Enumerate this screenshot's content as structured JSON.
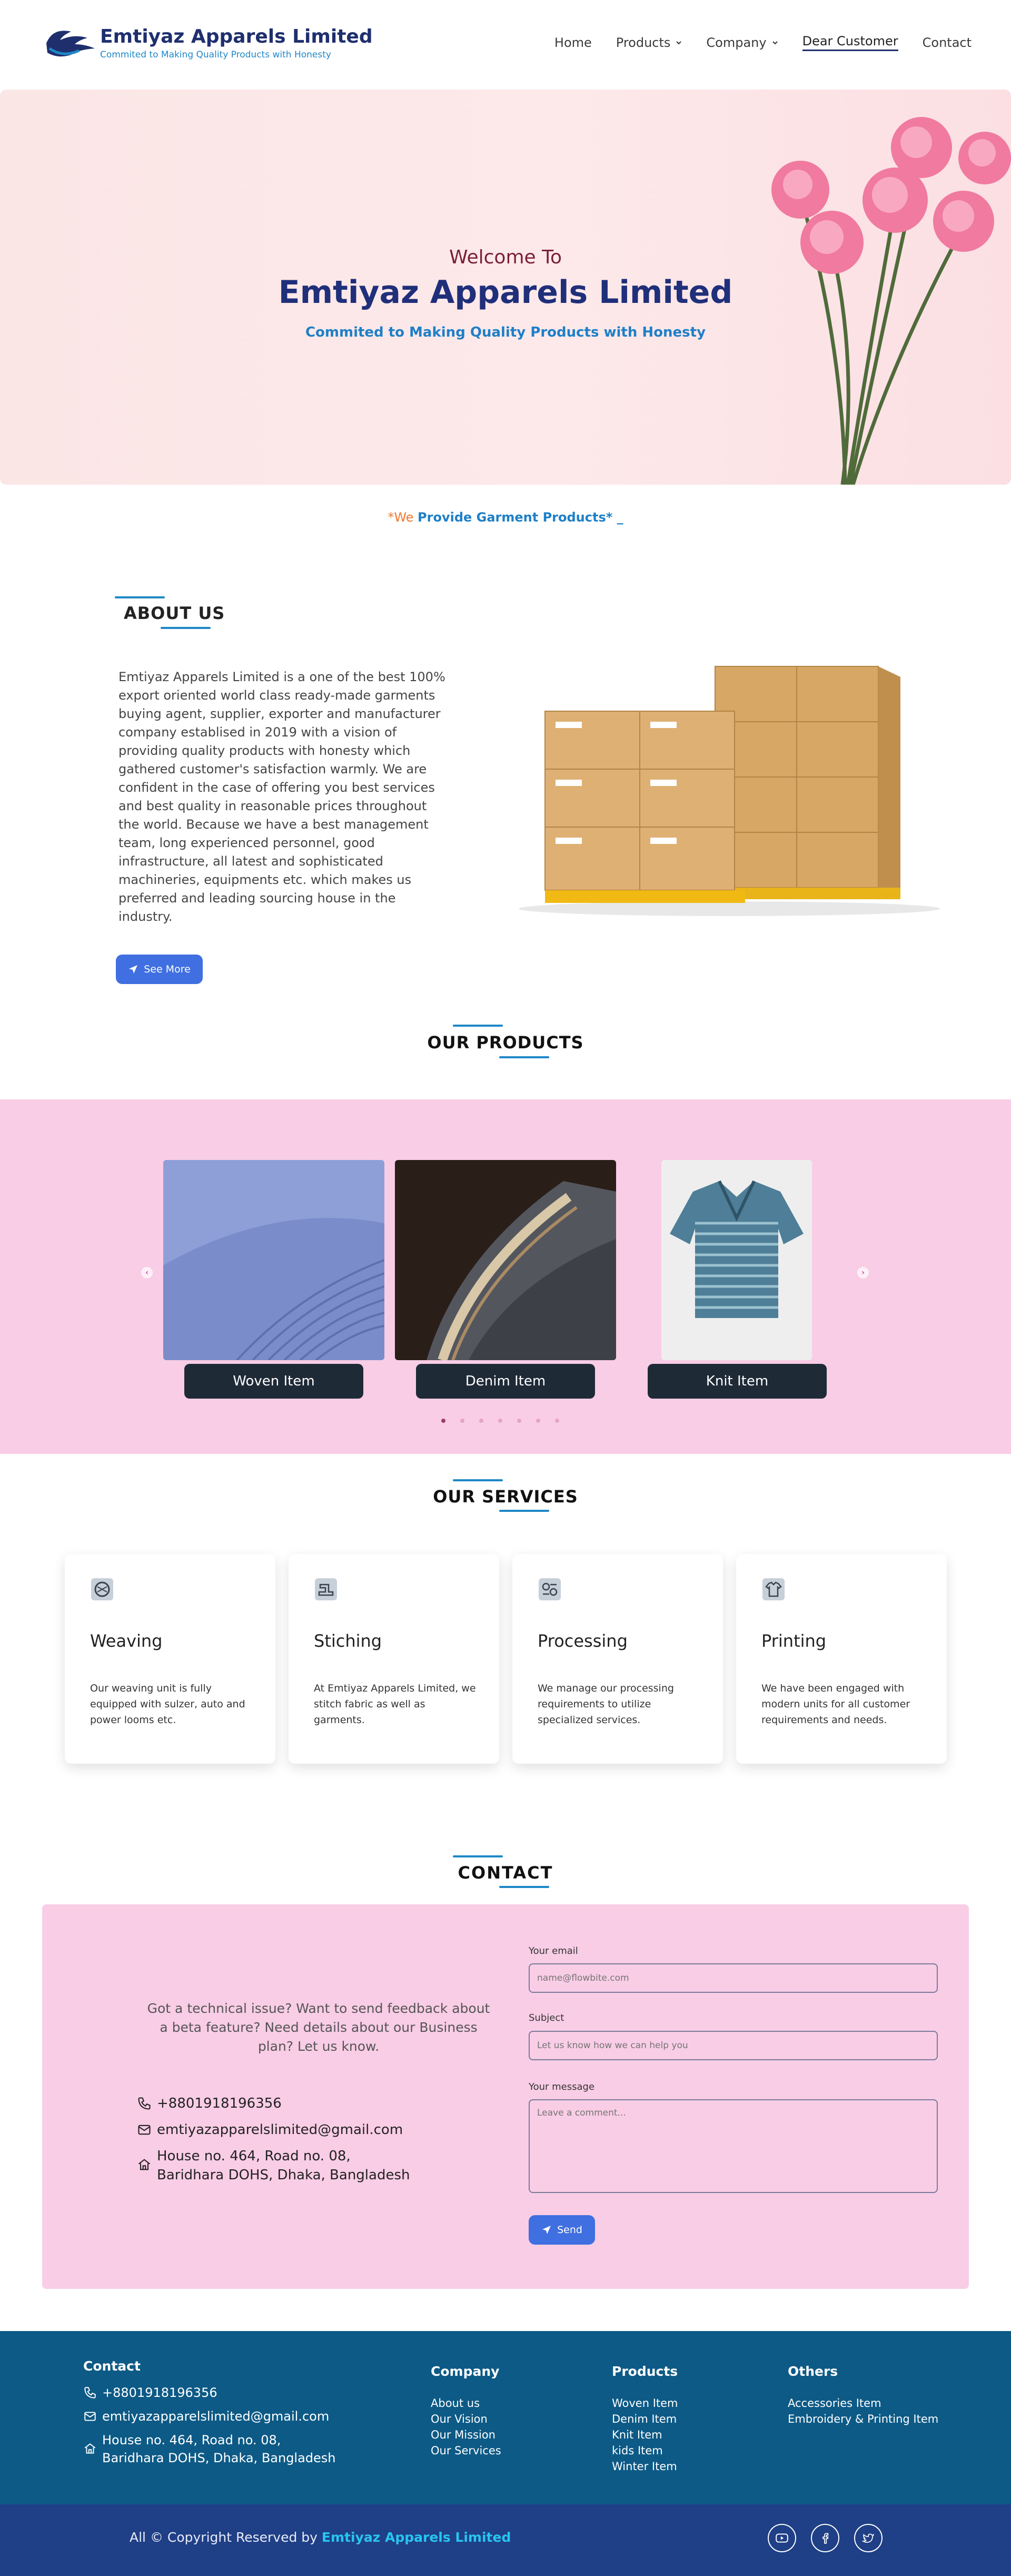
{
  "brand": {
    "name": "Emtiyaz Apparels Limited",
    "tagline": "Commited to Making Quality Products with Honesty"
  },
  "nav": {
    "items": [
      {
        "label": "Home"
      },
      {
        "label": "Products"
      },
      {
        "label": "Company"
      },
      {
        "label": "Dear Customer"
      },
      {
        "label": "Contact"
      }
    ]
  },
  "hero": {
    "welcome": "Welcome To",
    "title": "Emtiyaz Apparels Limited",
    "subtitle": "Commited to Making Quality Products with Honesty"
  },
  "tagline": {
    "prefix": "*We ",
    "main": "Provide Garment Products*",
    "cursor": " _"
  },
  "about": {
    "heading": "ABOUT US",
    "text": "Emtiyaz Apparels Limited is a one of the best 100% export oriented world class ready-made garments buying agent, supplier, exporter and manufacturer company establised in 2019 with a vision of providing quality products with honesty which gathered customer's satisfaction warmly. We are confident in the case of offering you best services and best quality in reasonable prices throughout the world. Because we have a best management team, long experienced personnel, good infrastructure, all latest and sophisticated machineries, equipments etc. which makes us preferred and leading sourcing house in the industry.",
    "button": "See More"
  },
  "products": {
    "heading": "OUR PRODUCTS",
    "items": [
      {
        "label": "Woven Item"
      },
      {
        "label": "Denim Item"
      },
      {
        "label": "Knit Item"
      }
    ],
    "dots": 7,
    "active_dot": 0
  },
  "services": {
    "heading": "OUR SERVICES",
    "items": [
      {
        "title": "Weaving",
        "desc": "Our weaving unit is fully equipped with sulzer, auto and power looms etc.",
        "icon": "weaving-icon"
      },
      {
        "title": "Stiching",
        "desc": "At Emtiyaz Apparels Limited, we stitch fabric as well as garments.",
        "icon": "sewing-machine-icon"
      },
      {
        "title": "Processing",
        "desc": "We manage our processing requirements to utilize specialized services.",
        "icon": "processing-icon"
      },
      {
        "title": "Printing",
        "desc": "We have been engaged with modern units for all customer requirements and needs.",
        "icon": "tshirt-print-icon"
      }
    ]
  },
  "contact": {
    "heading": "CONTACT",
    "question": "Got a technical issue? Want to send feedback about a beta feature? Need details about our Business plan? Let us know.",
    "phone": "+8801918196356",
    "email": "emtiyazapparelslimited@gmail.com",
    "address_line1": "House no. 464, Road no. 08,",
    "address_line2": "Baridhara DOHS, Dhaka, Bangladesh",
    "form": {
      "email_label": "Your email",
      "email_placeholder": "name@flowbite.com",
      "subject_label": "Subject",
      "subject_placeholder": "Let us know how we can help you",
      "message_label": "Your message",
      "message_placeholder": "Leave a comment...",
      "send": "Send"
    }
  },
  "footer": {
    "contact_title": "Contact",
    "phone": "+8801918196356",
    "email": "emtiyazapparelslimited@gmail.com",
    "address_line1": "House no. 464, Road no. 08,",
    "address_line2": "Baridhara DOHS, Dhaka, Bangladesh",
    "company_title": "Company",
    "company_links": [
      "About us",
      "Our Vision",
      "Our Mission",
      "Our Services"
    ],
    "products_title": "Products",
    "products_links": [
      "Woven Item",
      "Denim Item",
      "Knit Item",
      "kids Item",
      "Winter Item"
    ],
    "others_title": "Others",
    "others_links": [
      "Accessories Item",
      "Embroidery & Printing Item"
    ],
    "copyright_prefix": "All © Copyright Reserved by ",
    "copyright_brand": "Emtiyaz Apparels Limited",
    "social": [
      "youtube-icon",
      "facebook-icon",
      "twitter-icon"
    ]
  }
}
